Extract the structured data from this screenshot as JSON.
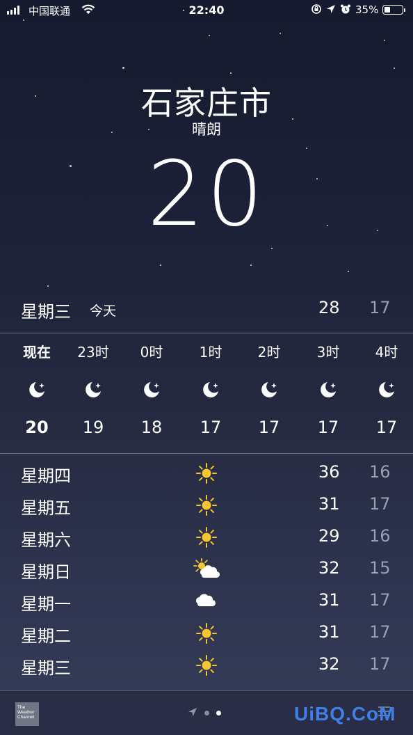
{
  "status_bar": {
    "carrier": "中国联通",
    "time": "22:40",
    "battery": "35%",
    "battery_level": 0.35,
    "icons": [
      "signal-icon",
      "wifi-icon",
      "rotation-lock-icon",
      "location-icon",
      "alarm-icon",
      "battery-icon"
    ]
  },
  "header": {
    "city": "石家庄市",
    "condition": "晴朗",
    "temperature": "20"
  },
  "today": {
    "day": "星期三",
    "label": "今天",
    "high": "28",
    "low": "17"
  },
  "hourly": [
    {
      "time": "现在",
      "icon": "moon-icon",
      "temp": "20"
    },
    {
      "time": "23时",
      "icon": "moon-icon",
      "temp": "19"
    },
    {
      "time": "0时",
      "icon": "moon-icon",
      "temp": "18"
    },
    {
      "time": "1时",
      "icon": "moon-icon",
      "temp": "17"
    },
    {
      "time": "2时",
      "icon": "moon-icon",
      "temp": "17"
    },
    {
      "time": "3时",
      "icon": "moon-icon",
      "temp": "17"
    },
    {
      "time": "4时",
      "icon": "moon-icon",
      "temp": "17"
    }
  ],
  "daily": [
    {
      "day": "星期四",
      "icon": "sun-icon",
      "high": "36",
      "low": "16"
    },
    {
      "day": "星期五",
      "icon": "sun-icon",
      "high": "31",
      "low": "17"
    },
    {
      "day": "星期六",
      "icon": "sun-icon",
      "high": "29",
      "low": "16"
    },
    {
      "day": "星期日",
      "icon": "partly-cloudy-icon",
      "high": "32",
      "low": "15"
    },
    {
      "day": "星期一",
      "icon": "cloud-icon",
      "high": "31",
      "low": "17"
    },
    {
      "day": "星期二",
      "icon": "sun-icon",
      "high": "31",
      "low": "17"
    },
    {
      "day": "星期三",
      "icon": "sun-icon",
      "high": "32",
      "low": "17"
    }
  ],
  "bottom_bar": {
    "logo_text": "The Weather Channel",
    "pages": 2,
    "active_page": 2
  },
  "watermark": "UiBQ.CoM",
  "colors": {
    "sun": "#f7c531",
    "low_temp": "#9aa0b4",
    "watermark": "#3f7fe8"
  }
}
